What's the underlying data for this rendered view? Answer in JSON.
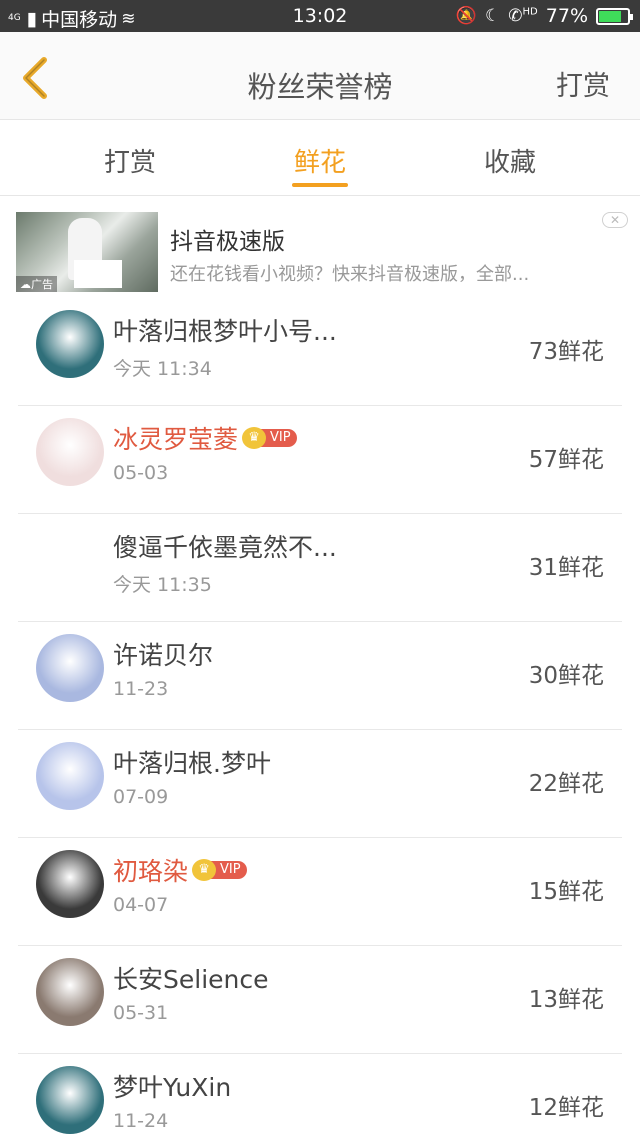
{
  "status_bar": {
    "network": "4G",
    "carrier": "中国移动",
    "time": "13:02",
    "battery_percent_text": "77%",
    "battery_level": 0.77,
    "hd": "HD"
  },
  "header": {
    "title": "粉丝荣誉榜",
    "action": "打赏"
  },
  "tabs": [
    {
      "label": "打赏",
      "active": false
    },
    {
      "label": "鲜花",
      "active": true
    },
    {
      "label": "收藏",
      "active": false
    }
  ],
  "ad": {
    "title": "抖音极速版",
    "description": "还在花钱看小视频？快来抖音极速版，全部...",
    "tag": "广告",
    "close": "✕"
  },
  "vip_label": "VIP",
  "rows": [
    {
      "name": "叶落归根梦叶小号...",
      "date": "今天 11:34",
      "count": "73鲜花",
      "vip": false,
      "avatar_color": "#2f6f7a"
    },
    {
      "name": "冰灵罗莹菱",
      "date": "05-03",
      "count": "57鲜花",
      "vip": true,
      "avatar_color": "#f0dede"
    },
    {
      "name": "傻逼千依墨竟然不...",
      "date": "今天 11:35",
      "count": "31鲜花",
      "vip": false,
      "avatar_color": ""
    },
    {
      "name": "许诺贝尔",
      "date": "11-23",
      "count": "30鲜花",
      "vip": false,
      "avatar_color": "#a9b8e0"
    },
    {
      "name": "叶落归根.梦叶",
      "date": "07-09",
      "count": "22鲜花",
      "vip": false,
      "avatar_color": "#b7c4ea"
    },
    {
      "name": "初珞染",
      "date": "04-07",
      "count": "15鲜花",
      "vip": true,
      "avatar_color": "#3a3a3a"
    },
    {
      "name": "长安Selience",
      "date": "05-31",
      "count": "13鲜花",
      "vip": false,
      "avatar_color": "#8a7a70"
    },
    {
      "name": "梦叶YuXin",
      "date": "11-24",
      "count": "12鲜花",
      "vip": false,
      "avatar_color": "#2f6f7a"
    }
  ]
}
